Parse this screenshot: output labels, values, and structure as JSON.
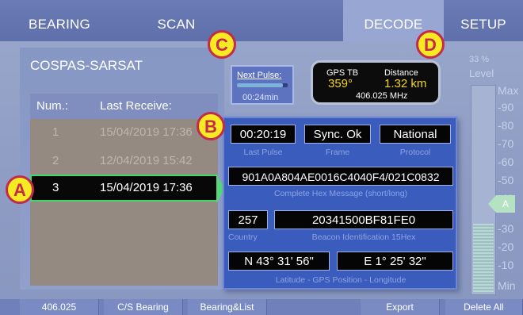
{
  "tabs": [
    "BEARING",
    "SCAN",
    "DECODE",
    "SETUP"
  ],
  "active_tab": "DECODE",
  "section_title": "COSPAS-SARSAT",
  "list": {
    "headers": [
      "Num.:",
      "Last Receive:"
    ],
    "rows": [
      {
        "num": "1",
        "date": "15/04/2019 17:36"
      },
      {
        "num": "2",
        "date": "12/04/2019 15:42"
      },
      {
        "num": "3",
        "date": "15/04/2019 17:36"
      }
    ],
    "selected_index": 2
  },
  "next_pulse": {
    "label": "Next Pulse:",
    "time": "00:24min",
    "progress": 0.9
  },
  "gps": {
    "gps_label": "GPS TB",
    "bearing": "359°",
    "distance_label": "Distance",
    "distance": "1.32 km",
    "frequency": "406.025 MHz"
  },
  "level": {
    "percent": "33 %",
    "label": "Level",
    "scale": [
      "Max",
      "-90",
      "-80",
      "-70",
      "-60",
      "-50",
      "-40",
      "-30",
      "-20",
      "-10",
      "Min"
    ],
    "marker": "A",
    "value": 0.33
  },
  "decode": {
    "last_pulse": "00:20:19",
    "frame": "Sync. Ok",
    "protocol": "National",
    "last_pulse_caption": "Last Pulse",
    "frame_caption": "Frame",
    "protocol_caption": "Protocol",
    "hex_message": "901A0A804AE0016C4040F4/021C0832",
    "hex_caption": "Complete Hex Message (short/long)",
    "country": "257",
    "beacon_id": "20341500BF81FE0",
    "country_caption": "Country",
    "beacon_caption": "Beacon Identification 15Hex",
    "latitude": "N 43° 31' 56\"",
    "longitude": "E 1° 25' 32\"",
    "position_caption": "Latitude - GPS Position - Longitude"
  },
  "bottom_buttons": [
    "406.025",
    "C/S Bearing",
    "Bearing&List",
    "Export",
    "Delete All"
  ],
  "callouts": [
    "A",
    "B",
    "C",
    "D"
  ],
  "colors": {
    "accent_green": "#3ed96a",
    "callout_yellow": "#f6ea22",
    "callout_red": "#c42a49",
    "gps_value": "#f2d51b"
  }
}
